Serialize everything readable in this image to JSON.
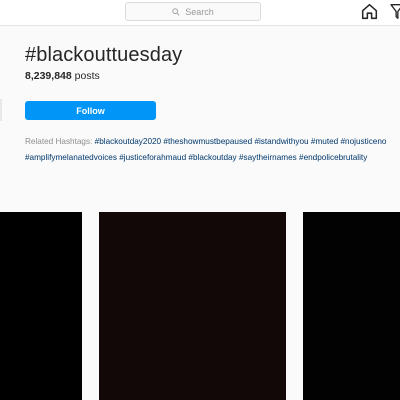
{
  "search": {
    "placeholder": "Search",
    "icon": "search-icon"
  },
  "nav": {
    "home_icon": "home-icon",
    "direct_icon": "send-icon"
  },
  "hashtag": {
    "title": "#blackouttuesday",
    "count": "8,239,848",
    "count_suffix": "posts"
  },
  "follow": {
    "label": "Follow"
  },
  "related": {
    "label": "Related Hashtags:",
    "line1": [
      "#blackoutday2020",
      "#theshowmustbepaused",
      "#istandwithyou",
      "#muted",
      "#nojusticeno"
    ],
    "line2": [
      "#amplifymelanatedvoices",
      "#justiceforahmaud",
      "#blackoutday",
      "#saytheirnames",
      "#endpolicebrutality"
    ]
  },
  "grid": {
    "tiles": [
      "black-post",
      "black-post",
      "black-post"
    ]
  },
  "colors": {
    "accent": "#0095f6",
    "tag_link": "#00376b",
    "tile_dark": "#000000"
  }
}
